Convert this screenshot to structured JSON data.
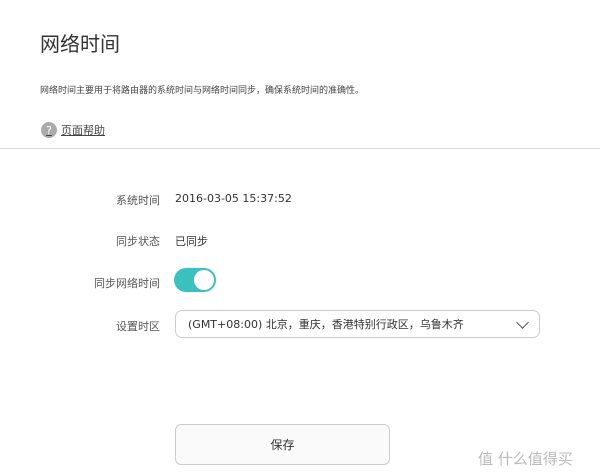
{
  "title": "网络时间",
  "description": "网络时间主要用于将路由器的系统时间与网络时间同步，确保系统时间的准确性。",
  "help_link": "页面帮助",
  "fields": {
    "system_time_label": "系统时间",
    "system_time_value": "2016-03-05 15:37:52",
    "sync_status_label": "同步状态",
    "sync_status_value": "已同步",
    "sync_network_label": "同步网络时间",
    "sync_network_on": true,
    "timezone_label": "设置时区",
    "timezone_value": "(GMT+08:00) 北京，重庆，香港特别行政区，乌鲁木齐"
  },
  "save_label": "保存",
  "watermark": "值 什么值得买",
  "colors": {
    "accent": "#3cbfbf"
  }
}
